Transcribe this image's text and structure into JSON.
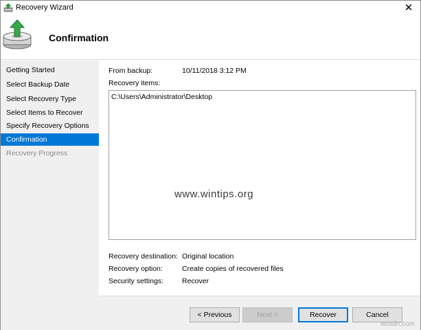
{
  "window": {
    "title": "Recovery Wizard",
    "close_glyph": "✕"
  },
  "header": {
    "title": "Confirmation",
    "icon": "backup-drive-restore-icon"
  },
  "sidebar": {
    "items": [
      {
        "label": "Getting Started",
        "state": "normal"
      },
      {
        "label": "Select Backup Date",
        "state": "normal"
      },
      {
        "label": "Select Recovery Type",
        "state": "normal"
      },
      {
        "label": "Select Items to Recover",
        "state": "normal"
      },
      {
        "label": "Specify Recovery Options",
        "state": "normal"
      },
      {
        "label": "Confirmation",
        "state": "active"
      },
      {
        "label": "Recovery Progress",
        "state": "disabled"
      }
    ]
  },
  "content": {
    "from_backup_label": "From backup:",
    "from_backup_value": "10/11/2018 3:12 PM",
    "recovery_items_label": "Recovery items:",
    "recovery_items": [
      "C:\\Users\\Administrator\\Desktop"
    ],
    "watermark": "www.wintips.org",
    "recovery_destination_label": "Recovery destination:",
    "recovery_destination_value": "Original location",
    "recovery_option_label": "Recovery option:",
    "recovery_option_value": "Create copies of recovered files",
    "security_settings_label": "Security settings:",
    "security_settings_value": "Recover"
  },
  "footer": {
    "previous_label": "< Previous",
    "next_label": "Next >",
    "recover_label": "Recover",
    "cancel_label": "Cancel",
    "brand": "wsxdn.com"
  },
  "colors": {
    "accent": "#0078d7",
    "sidebar_bg": "#f0f0f0",
    "disabled_text": "#8a8a8a"
  }
}
